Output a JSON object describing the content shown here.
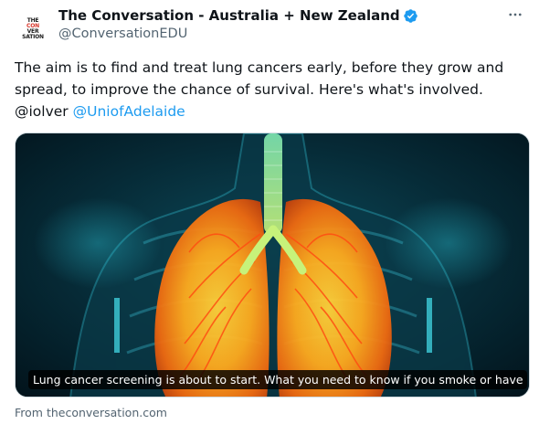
{
  "author": {
    "display_name": "The Conversation - Australia + New Zealand",
    "handle": "@ConversationEDU",
    "avatar_text": [
      "THE",
      "CON",
      "VER",
      "SATION"
    ]
  },
  "tweet": {
    "text": "The aim is to find and treat lung cancers early, before they grow and spread, to improve the chance of survival. Here's what's involved. @iolver ",
    "mention": "@UniofAdelaide"
  },
  "card": {
    "caption": "Lung cancer screening is about to start. What you need to know if you smoke or have q...",
    "source": "From theconversation.com"
  },
  "icons": {
    "verified": "verified-badge-icon",
    "more": "more-options-icon"
  },
  "colors": {
    "accent": "#1d9bf0",
    "muted": "#536471",
    "text": "#0f1419"
  }
}
